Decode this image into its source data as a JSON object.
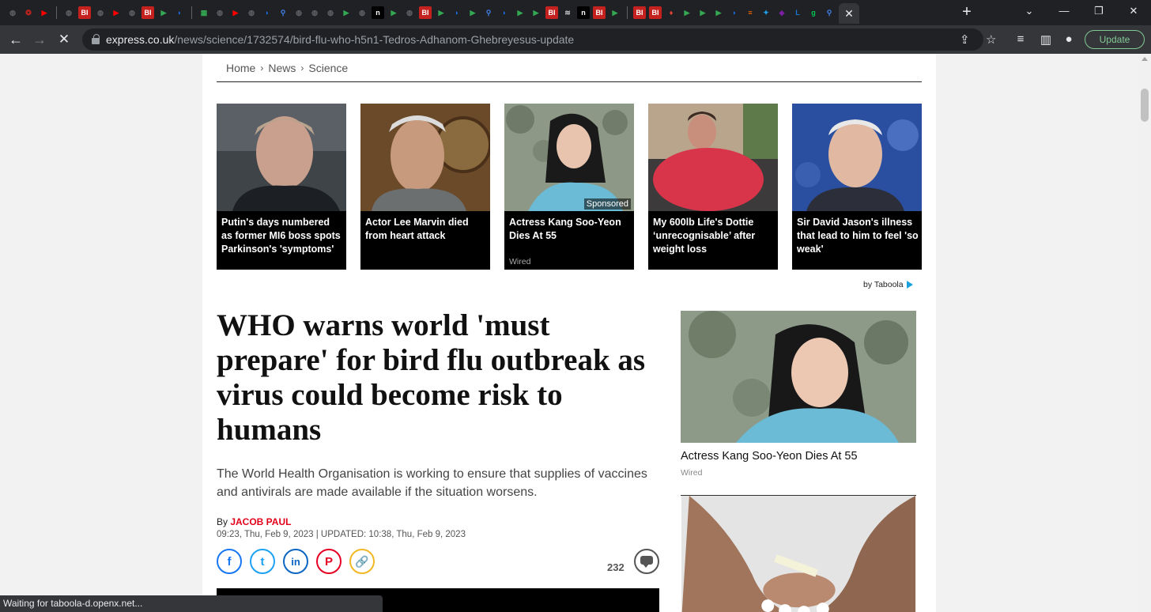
{
  "browser": {
    "tab_favicons": [
      "globe",
      "red-logo",
      "youtube",
      "sep",
      "globe",
      "BI",
      "globe",
      "youtube",
      "globe",
      "BI",
      "play",
      "shield",
      "sep",
      "map",
      "globe",
      "youtube",
      "globe",
      "shield",
      "search",
      "globe",
      "globe",
      "globe",
      "play",
      "globe",
      "n",
      "play",
      "globe",
      "BI",
      "play",
      "shield",
      "play",
      "search",
      "shield",
      "play",
      "play",
      "BI",
      "wavy",
      "n",
      "BI",
      "play",
      "sep",
      "BI",
      "BI",
      "pin",
      "play",
      "play",
      "play",
      "shield",
      "bars",
      "twitter",
      "purple",
      "LIFE",
      "g",
      "search"
    ],
    "active_tab_close": "✕",
    "new_tab": "+",
    "window_controls": [
      "⌄",
      "—",
      "❐",
      "✕"
    ],
    "url_host": "express.co.uk",
    "url_path": "/news/science/1732574/bird-flu-who-h5n1-Tedros-Adhanom-Ghebreyesus-update",
    "update_label": "Update",
    "status_text": "Waiting for taboola-d.openx.net..."
  },
  "breadcrumb": [
    "Home",
    "News",
    "Science"
  ],
  "taboola": {
    "cards": [
      {
        "title": "Putin's days numbered as former MI6 boss spots Parkinson's 'symptoms'",
        "source": "",
        "sponsored": false
      },
      {
        "title": "Actor Lee Marvin died from heart attack",
        "source": "",
        "sponsored": false
      },
      {
        "title": "Actress Kang Soo-Yeon Dies At 55",
        "source": "Wired",
        "sponsored": true
      },
      {
        "title": "My 600lb Life's Dottie ‘unrecognisable’ after weight loss",
        "source": "",
        "sponsored": false
      },
      {
        "title": "Sir David Jason's illness that lead to him to feel 'so weak'",
        "source": "",
        "sponsored": false
      }
    ],
    "sponsored_label": "Sponsored",
    "by_label": "by Taboola"
  },
  "article": {
    "headline": "WHO warns world 'must prepare' for bird flu outbreak as virus could become risk to humans",
    "standfirst": "The World Health Organisation is working to ensure that supplies of vaccines and antivirals are made available if the situation worsens.",
    "by_prefix": "By ",
    "author": "JACOB PAUL",
    "dateline": "09:23, Thu, Feb 9, 2023 | UPDATED: 10:38, Thu, Feb 9, 2023",
    "comment_count": "232",
    "share": {
      "facebook": "f",
      "twitter": "t",
      "linkedin": "in",
      "pinterest": "P",
      "link": "🔗"
    }
  },
  "sidebar": {
    "promo_title": "Actress Kang Soo-Yeon Dies At 55",
    "promo_source": "Wired"
  }
}
